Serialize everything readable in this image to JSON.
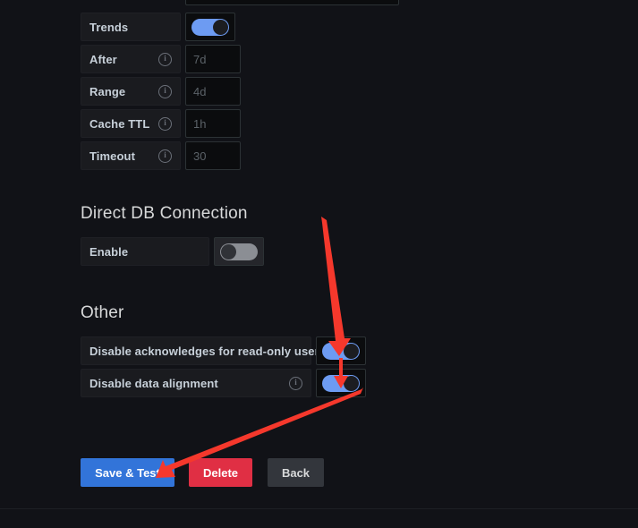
{
  "theme": {
    "page_background": "#111217",
    "panel_background": "#1a1b1f",
    "input_background": "#0b0c0e",
    "accent_blue": "#3274d9",
    "toggle_on": "#6d9bf2",
    "danger_red": "#e02f44",
    "neutral_gray": "#33363c",
    "annotation_red": "#f5382c",
    "text_primary": "#d8d9da",
    "text_label": "#c7d0d9",
    "placeholder": "#5b6268"
  },
  "settings_rows": [
    {
      "label": "Trends",
      "has_info_icon": false,
      "control": "toggle",
      "toggle_state": "on",
      "value": "",
      "placeholder": ""
    },
    {
      "label": "After",
      "has_info_icon": true,
      "control": "input",
      "toggle_state": "",
      "value": "",
      "placeholder": "7d"
    },
    {
      "label": "Range",
      "has_info_icon": true,
      "control": "input",
      "toggle_state": "",
      "value": "",
      "placeholder": "4d"
    },
    {
      "label": "Cache TTL",
      "has_info_icon": true,
      "control": "input",
      "toggle_state": "",
      "value": "",
      "placeholder": "1h"
    },
    {
      "label": "Timeout",
      "has_info_icon": true,
      "control": "input",
      "toggle_state": "",
      "value": "",
      "placeholder": "30"
    }
  ],
  "direct_db_section": {
    "heading": "Direct DB Connection",
    "rows": [
      {
        "label": "Enable",
        "has_info_icon": false,
        "control": "toggle",
        "toggle_state": "off"
      }
    ]
  },
  "other_section": {
    "heading": "Other",
    "rows": [
      {
        "label": "Disable acknowledges for read-only users",
        "has_info_icon": false,
        "control": "toggle",
        "toggle_state": "on"
      },
      {
        "label": "Disable data alignment",
        "has_info_icon": true,
        "control": "toggle",
        "toggle_state": "on"
      }
    ]
  },
  "actions": {
    "save_label": "Save & Test",
    "delete_label": "Delete",
    "back_label": "Back"
  },
  "icons": {
    "info": "i"
  }
}
